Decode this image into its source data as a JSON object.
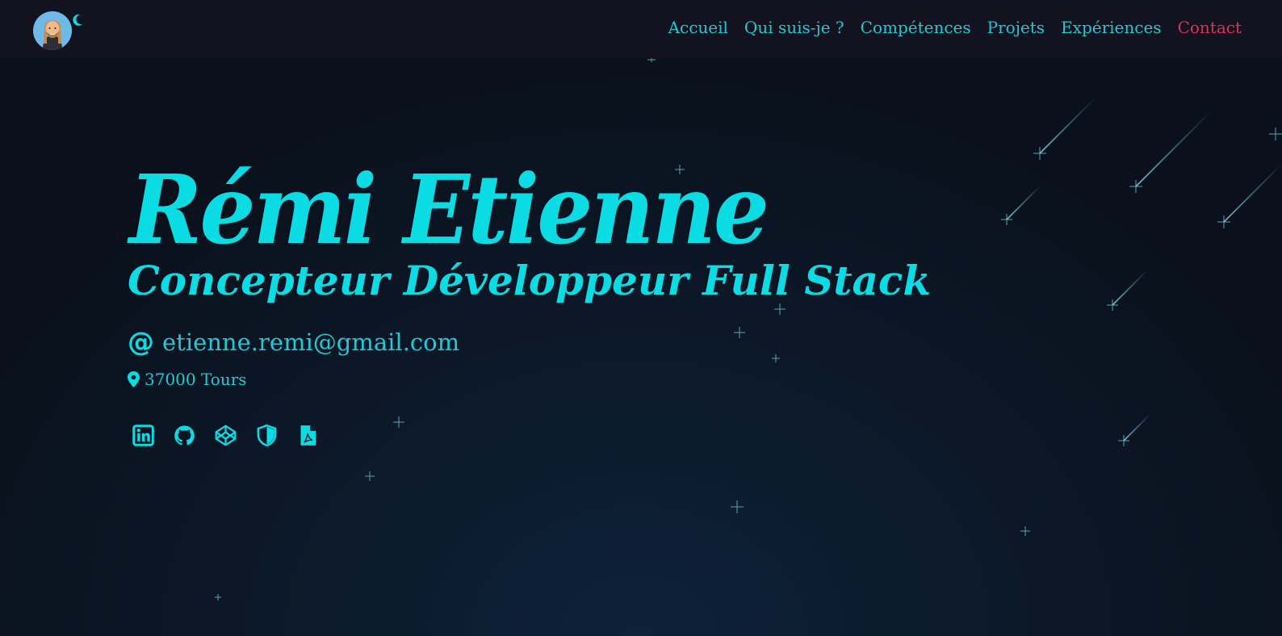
{
  "theme": {
    "accent": "#0bdbe2",
    "link": "#1fc9d6",
    "active": "#e0305a",
    "navbar_bg": "#13121f"
  },
  "header": {
    "avatar_icon": "bearded-man-avatar",
    "theme_toggle_icon": "moon-icon",
    "nav": [
      {
        "label": "Accueil",
        "active": false
      },
      {
        "label": "Qui suis-je ?",
        "active": false
      },
      {
        "label": "Compétences",
        "active": false
      },
      {
        "label": "Projets",
        "active": false
      },
      {
        "label": "Expériences",
        "active": false
      },
      {
        "label": "Contact",
        "active": true
      }
    ]
  },
  "hero": {
    "name": "Rémi Etienne",
    "role": "Concepteur Développeur Full Stack",
    "email_symbol": "@",
    "email": "etienne.remi@gmail.com",
    "location": "37000 Tours"
  },
  "socials": [
    {
      "icon": "linkedin-icon"
    },
    {
      "icon": "github-icon"
    },
    {
      "icon": "codepen-icon"
    },
    {
      "icon": "shield-icon"
    },
    {
      "icon": "pdf-file-icon"
    }
  ]
}
